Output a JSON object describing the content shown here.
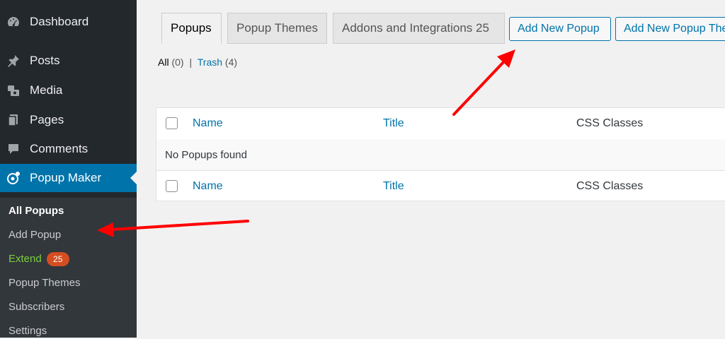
{
  "sidebar": {
    "menu": [
      {
        "label": "Dashboard",
        "icon": "dashboard-icon"
      },
      {
        "label": "Posts",
        "icon": "pin-icon"
      },
      {
        "label": "Media",
        "icon": "media-icon"
      },
      {
        "label": "Pages",
        "icon": "pages-icon"
      },
      {
        "label": "Comments",
        "icon": "comment-icon"
      },
      {
        "label": "Popup Maker",
        "icon": "popup-maker-icon"
      }
    ],
    "submenu": [
      {
        "label": "All Popups"
      },
      {
        "label": "Add Popup"
      },
      {
        "label": "Extend",
        "badge": "25"
      },
      {
        "label": "Popup Themes"
      },
      {
        "label": "Subscribers"
      },
      {
        "label": "Settings"
      }
    ]
  },
  "tabs": [
    {
      "label": "Popups"
    },
    {
      "label": "Popup Themes"
    },
    {
      "label": "Addons and Integrations 25"
    }
  ],
  "buttons": {
    "add_new_popup": "Add New Popup",
    "add_new_popup_theme": "Add New Popup Theme"
  },
  "filters": {
    "all_label": "All",
    "all_count": "(0)",
    "separator": "|",
    "trash_label": "Trash",
    "trash_count": "(4)"
  },
  "table": {
    "columns": [
      "Name",
      "Title",
      "CSS Classes"
    ],
    "empty_message": "No Popups found"
  },
  "colors": {
    "sidebar_bg": "#23282d",
    "active_menu": "#0073aa",
    "link": "#0073aa",
    "annotation_arrow": "#ff0000"
  }
}
